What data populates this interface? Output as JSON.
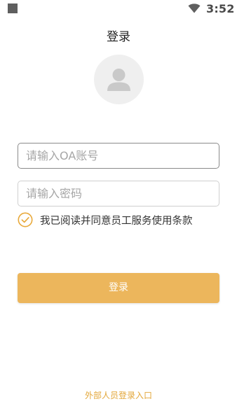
{
  "status_bar": {
    "time": "3:52",
    "left_icon": "notification-square-icon",
    "wifi_icon": "wifi-icon"
  },
  "header": {
    "title": "登录",
    "avatar_icon": "user-avatar-icon"
  },
  "form": {
    "account_placeholder": "请输入OA账号",
    "account_value": "",
    "password_placeholder": "请输入密码",
    "password_value": "",
    "agreement_text": "我已阅读并同意员工服务使用条款",
    "agreement_checked": true,
    "login_label": "登录"
  },
  "footer": {
    "external_login_label": "外部人员登录入口"
  },
  "colors": {
    "accent": "#ecb65c",
    "check": "#e8a93a",
    "link": "#e3a73a"
  }
}
